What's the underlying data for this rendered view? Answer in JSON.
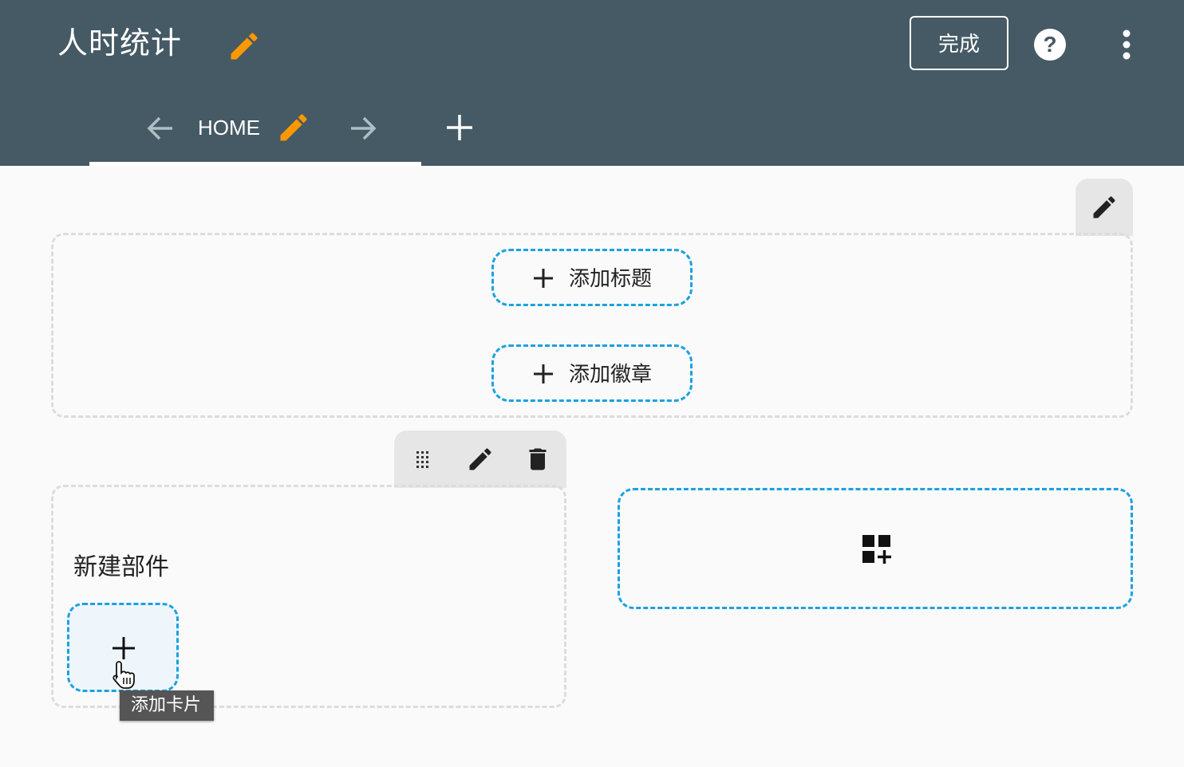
{
  "header": {
    "title": "人时统计",
    "done_label": "完成",
    "icons": [
      "pencil-icon",
      "help-icon",
      "more-vert-icon"
    ],
    "accent_color": "#ff9800"
  },
  "tabs": {
    "items": [
      {
        "label": "HOME"
      }
    ],
    "icons": [
      "arrow-left-icon",
      "pencil-icon",
      "arrow-right-icon",
      "plus-icon"
    ]
  },
  "header_section": {
    "add_title_label": "添加标题",
    "add_badge_label": "添加徽章"
  },
  "card": {
    "title": "新建部件",
    "toolbar_icons": [
      "drag-handle-icon",
      "pencil-icon",
      "trash-icon"
    ],
    "add_card_tooltip": "添加卡片"
  },
  "colors": {
    "topbar": "#455a64",
    "dashed_accent": "#1ba1e2",
    "background": "#fafafa"
  }
}
